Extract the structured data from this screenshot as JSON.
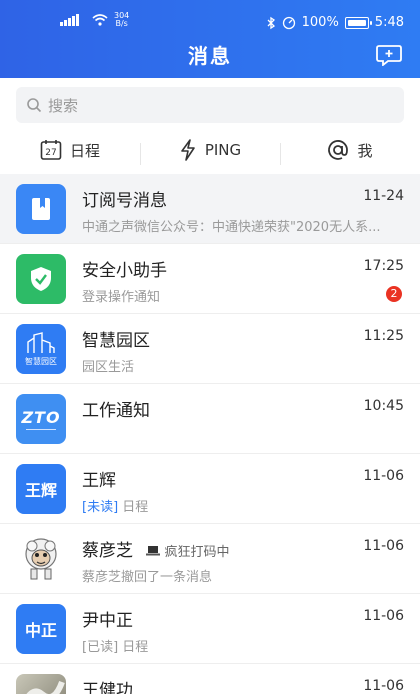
{
  "status_bar": {
    "net_speed": "304",
    "net_unit": "B/s",
    "battery": "100%",
    "time": "5:48"
  },
  "header": {
    "title": "消息",
    "compose_icon": "compose-message-icon"
  },
  "search": {
    "placeholder": "搜索"
  },
  "tabs": [
    {
      "icon": "calendar-icon",
      "icon_text": "27",
      "label": "日程"
    },
    {
      "icon": "lightning-icon",
      "label": "PING"
    },
    {
      "icon": "at-icon",
      "label": "我"
    }
  ],
  "messages": [
    {
      "name": "订阅号消息",
      "time": "11-24",
      "subtitle": "中通之声微信公众号：中通快递荣获\"2020无人系...",
      "avatar_icon": "bookmark-icon",
      "avatar_color": "#3a87f5"
    },
    {
      "name": "安全小助手",
      "time": "17:25",
      "subtitle": "登录操作通知",
      "badge": "2",
      "avatar_icon": "shield-check-icon",
      "avatar_color": "#2dbb67"
    },
    {
      "name": "智慧园区",
      "time": "11:25",
      "subtitle": "园区生活",
      "avatar_icon": "buildings-icon",
      "avatar_text": "智慧园区",
      "avatar_color": "#2f7cf3"
    },
    {
      "name": "工作通知",
      "time": "10:45",
      "subtitle": "",
      "avatar_icon": "zto-logo-icon",
      "avatar_text": "ZTO",
      "avatar_color": "#3f8ff2"
    },
    {
      "name": "王辉",
      "time": "11-06",
      "unread_tag": "[未读]",
      "subtitle": "日程",
      "avatar_text": "王辉",
      "avatar_color": "#2f7cf3"
    },
    {
      "name": "蔡彦芝",
      "time": "11-06",
      "status_note": "疯狂打码中",
      "subtitle": "蔡彦芝撤回了一条消息",
      "avatar_icon": "sheep-avatar-icon",
      "avatar_color": "#ffffff"
    },
    {
      "name": "尹中正",
      "time": "11-06",
      "read_tag": "[已读]",
      "subtitle": "日程",
      "avatar_text": "中正",
      "avatar_color": "#2f7cf3"
    },
    {
      "name": "王健功",
      "time": "11-06",
      "subtitle": "",
      "avatar_icon": "photo-avatar-icon",
      "avatar_color": "#8e8e7c"
    }
  ]
}
